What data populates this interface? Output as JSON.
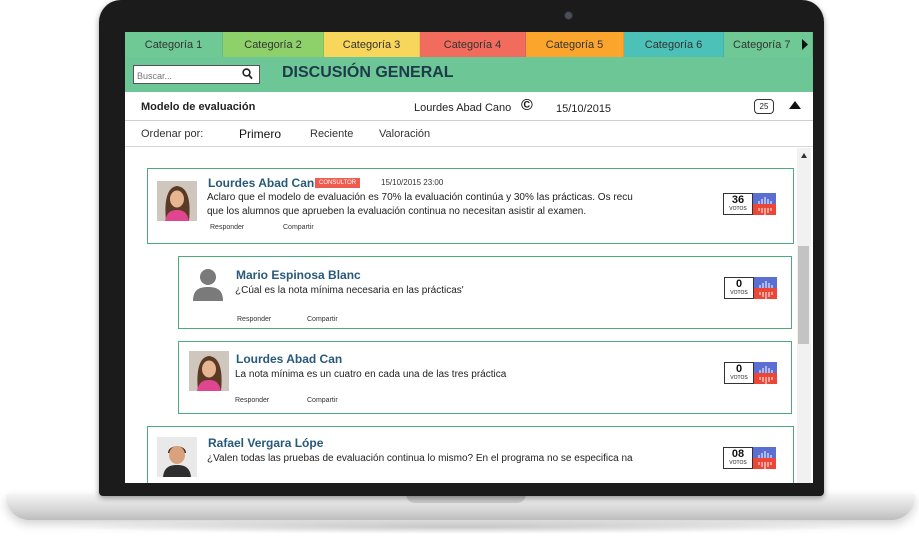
{
  "tabs": [
    {
      "label": "Categoría 1",
      "color": "#6ec995"
    },
    {
      "label": "Categoría 2",
      "color": "#8ed16b"
    },
    {
      "label": "Categoría 3",
      "color": "#f8d55b"
    },
    {
      "label": "Categoría 4",
      "color": "#f26c5d"
    },
    {
      "label": "Categoría 5",
      "color": "#fca52d"
    },
    {
      "label": "Categoría 6",
      "color": "#4cc1b8"
    },
    {
      "label": "Categoría 7",
      "color": "#6ec995"
    }
  ],
  "header": {
    "search_placeholder": "Buscar...",
    "title": "DISCUSIÓN GENERAL",
    "color": "#6dc695"
  },
  "topic": {
    "title": "Modelo de evaluación",
    "author": "Lourdes Abad Cano",
    "copyright_symbol": "©",
    "date": "15/10/2015",
    "comment_count": "25"
  },
  "sort": {
    "label": "Ordenar por:",
    "options": [
      "Primero",
      "Reciente",
      "Valoración"
    ]
  },
  "comments": [
    {
      "name": "Lourdes Abad Can",
      "badge": "CONSULTOR",
      "timestamp": "15/10/2015 23:00",
      "line1": "Aclaro que el modelo de evaluación es 70% la evaluación continúa y 30% las prácticas. Os recu",
      "line2": "que los alumnos que aprueben la evaluación continua no necesitan asistir al examen.",
      "reply": "Responder",
      "share": "Compartir",
      "votes": "36",
      "votes_label": "VOTOS"
    },
    {
      "name": "Mario Espinosa Blanc",
      "line1": "¿Cúal es la nota mínima necesaria en las prácticas'",
      "reply": "Responder",
      "share": "Compartir",
      "votes": "0",
      "votes_label": "VOTOS"
    },
    {
      "name": "Lourdes Abad Can",
      "line1": "La nota mínima es un cuatro en cada una de las tres práctica",
      "reply": "Responder",
      "share": "Compartir",
      "votes": "0",
      "votes_label": "VOTOS"
    },
    {
      "name": "Rafael Vergara Lópe",
      "line1": "¿Valen todas las pruebas de evaluación continua lo mismo? En el programa no se especifica na",
      "votes": "08",
      "votes_label": "VOTOS"
    }
  ]
}
